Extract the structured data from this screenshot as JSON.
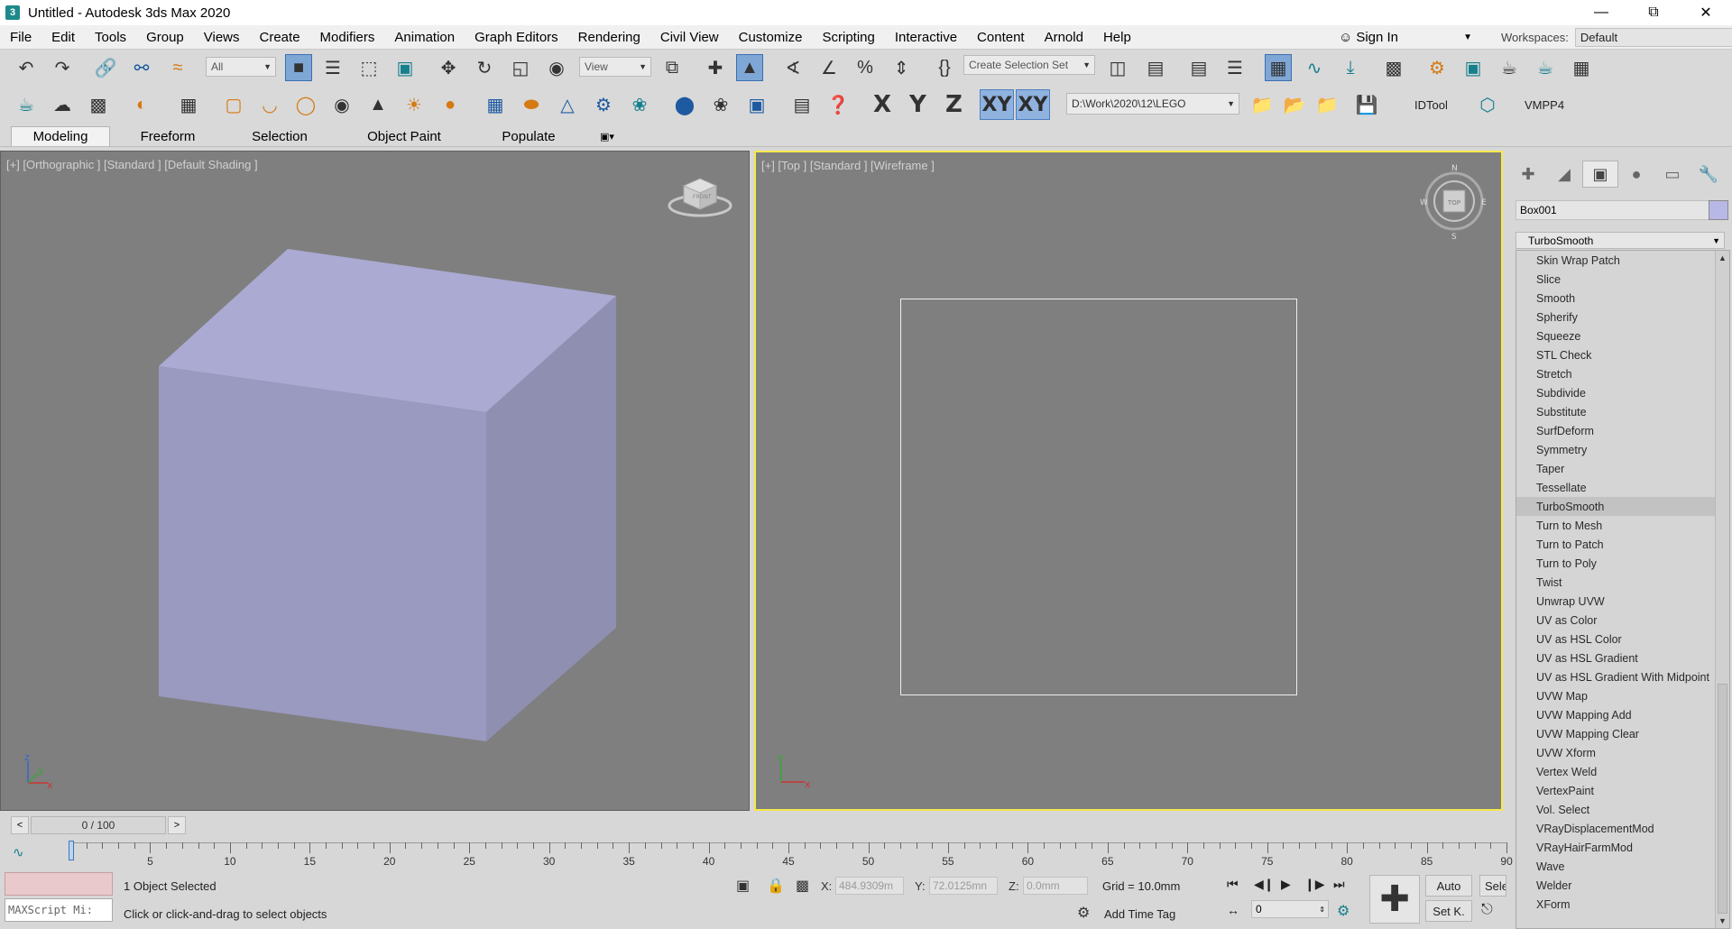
{
  "window": {
    "title": "Untitled - Autodesk 3ds Max 2020",
    "app_icon": "3"
  },
  "menu": [
    "File",
    "Edit",
    "Tools",
    "Group",
    "Views",
    "Create",
    "Modifiers",
    "Animation",
    "Graph Editors",
    "Rendering",
    "Civil View",
    "Customize",
    "Scripting",
    "Interactive",
    "Content",
    "Arnold",
    "Help"
  ],
  "account": {
    "sign_in": "Sign In",
    "workspaces_label": "Workspaces:",
    "workspace_value": "Default"
  },
  "toolbar": {
    "filter_value": "All",
    "refcoord_value": "View",
    "selection_set_value": "Create Selection Set",
    "axis_x": "X",
    "axis_y": "Y",
    "axis_z": "Z",
    "axis_xy": "XY",
    "axis_xy2": "XY",
    "project_path": "D:\\Work\\2020\\12\\LEGO",
    "idtool_label": "IDTool",
    "vmpp_label": "VMPP4"
  },
  "ribbon": {
    "tabs": [
      "Modeling",
      "Freeform",
      "Selection",
      "Object Paint",
      "Populate"
    ],
    "active": "Modeling"
  },
  "viewports": {
    "left_label": "[+] [Orthographic ] [Standard ] [Default Shading ]",
    "right_label": "[+] [Top ] [Standard ] [Wireframe ]",
    "cube_face": "FRONT",
    "viewcube_top": "TOP",
    "compass": {
      "n": "N",
      "s": "S",
      "e": "E",
      "w": "W"
    },
    "axis_x": "x",
    "axis_y": "y",
    "axis_z": "z"
  },
  "command_panel": {
    "object_name": "Box001",
    "object_color": "#b8b8e6",
    "modifier_selected": "TurboSmooth",
    "modifiers": [
      "Skin Wrap Patch",
      "Slice",
      "Smooth",
      "Spherify",
      "Squeeze",
      "STL Check",
      "Stretch",
      "Subdivide",
      "Substitute",
      "SurfDeform",
      "Symmetry",
      "Taper",
      "Tessellate",
      "TurboSmooth",
      "Turn to Mesh",
      "Turn to Patch",
      "Turn to Poly",
      "Twist",
      "Unwrap UVW",
      "UV as Color",
      "UV as HSL Color",
      "UV as HSL Gradient",
      "UV as HSL Gradient With Midpoint",
      "UVW Map",
      "UVW Mapping Add",
      "UVW Mapping Clear",
      "UVW Xform",
      "Vertex Weld",
      "VertexPaint",
      "Vol. Select",
      "VRayDisplacementMod",
      "VRayHairFarmMod",
      "Wave",
      "Welder",
      "XForm"
    ]
  },
  "timeline": {
    "position": "0 / 100",
    "prev": "<",
    "next": ">",
    "ticks": [
      "5",
      "10",
      "15",
      "20",
      "25",
      "30",
      "35",
      "40",
      "45",
      "50",
      "55",
      "60",
      "65",
      "70",
      "75",
      "80",
      "85",
      "90"
    ]
  },
  "status": {
    "maxscript_placeholder": "MAXScript Mi:",
    "selection": "1 Object Selected",
    "prompt": "Click or click-and-drag to select objects",
    "x_label": "X:",
    "x_value": "484.9309m",
    "y_label": "Y:",
    "y_value": "72.0125mn",
    "z_label": "Z:",
    "z_value": "0.0mm",
    "grid": "Grid = 10.0mm",
    "add_time_tag": "Add Time Tag",
    "auto_key": "Auto",
    "set_key": "Set K.",
    "selected_btn": "Selec",
    "frame_value": "0"
  },
  "colors": {
    "cube_top": "#abaad3",
    "cube_front": "#9a99c0",
    "cube_side": "#8f8fb2",
    "viewport_bg": "#7f7f7f",
    "active_border": "#f5e94a"
  }
}
